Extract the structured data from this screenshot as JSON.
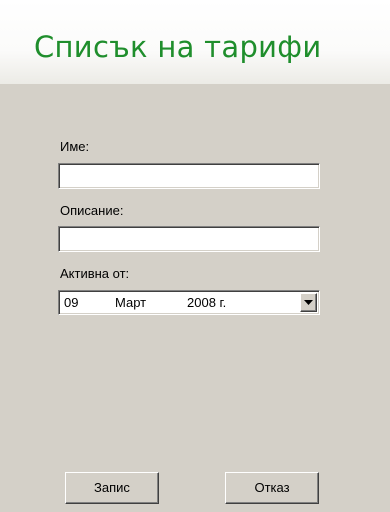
{
  "header": {
    "title": "Списък на тарифи"
  },
  "form": {
    "name_label": "Име:",
    "name_value": "",
    "description_label": "Описание:",
    "description_value": "",
    "active_from_label": "Активна от:",
    "active_from": {
      "day": "09",
      "month": "Март",
      "year": "2008 г."
    }
  },
  "buttons": {
    "save_label": "Запис",
    "cancel_label": "Отказ"
  },
  "colors": {
    "title": "#1f8e2c",
    "panel": "#d4d0c8"
  },
  "icons": {
    "dropdown": "chevron-down-icon"
  }
}
